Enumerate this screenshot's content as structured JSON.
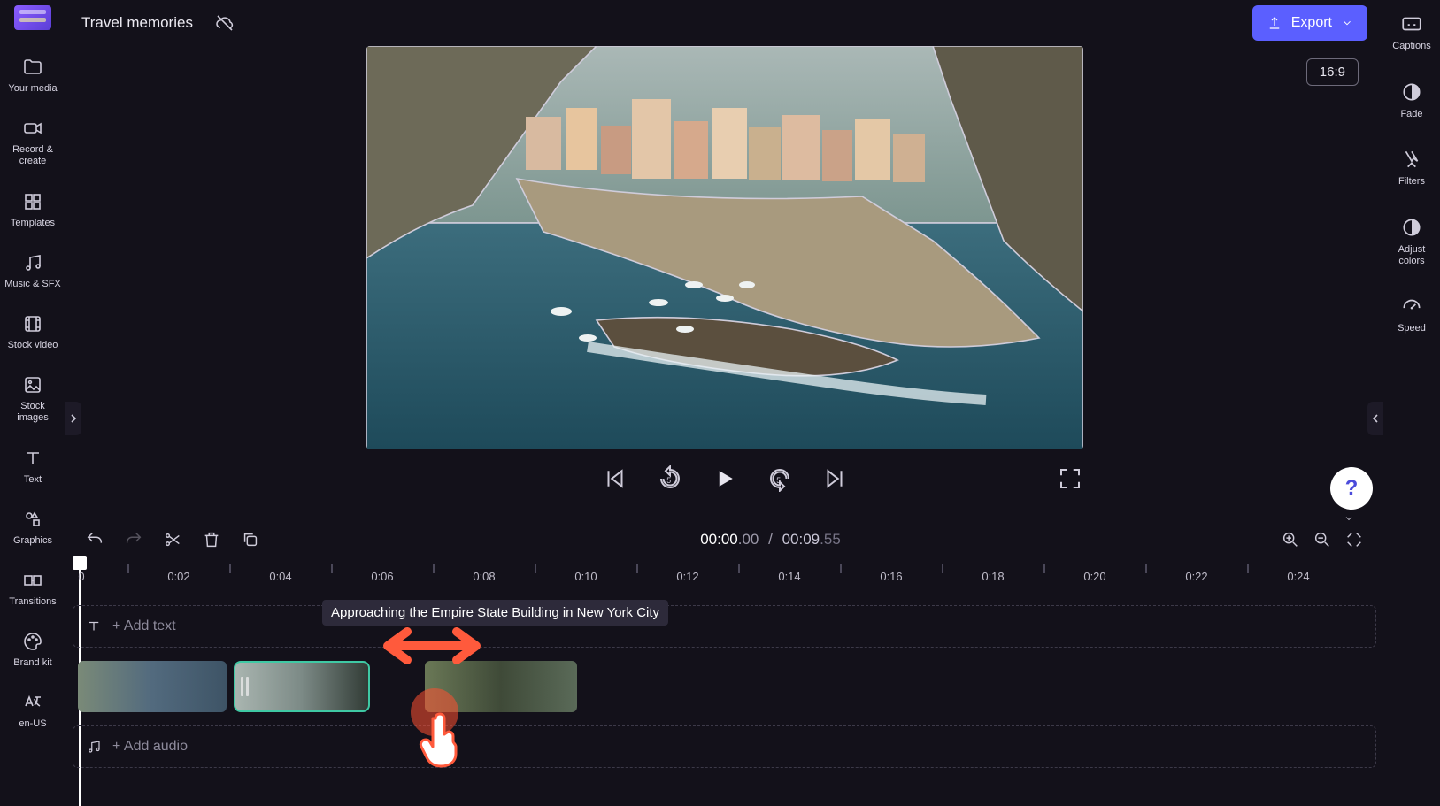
{
  "header": {
    "project_title": "Travel memories",
    "export_label": "Export",
    "aspect_ratio": "16:9"
  },
  "left_sidebar": {
    "items": [
      {
        "label": "Your media",
        "icon": "folder-icon"
      },
      {
        "label": "Record &\\ncreate",
        "icon": "camera-icon"
      },
      {
        "label": "Templates",
        "icon": "grid-icon"
      },
      {
        "label": "Music & SFX",
        "icon": "music-icon"
      },
      {
        "label": "Stock video",
        "icon": "film-icon"
      },
      {
        "label": "Stock\\nimages",
        "icon": "image-icon"
      },
      {
        "label": "Text",
        "icon": "text-icon"
      },
      {
        "label": "Graphics",
        "icon": "shapes-icon"
      },
      {
        "label": "Transitions",
        "icon": "transition-icon"
      },
      {
        "label": "Brand kit",
        "icon": "palette-icon"
      },
      {
        "label": "en-US",
        "icon": "language-icon"
      }
    ]
  },
  "right_sidebar": {
    "items": [
      {
        "label": "Captions",
        "icon": "captions-icon"
      },
      {
        "label": "Fade",
        "icon": "fade-icon"
      },
      {
        "label": "Filters",
        "icon": "filters-icon"
      },
      {
        "label": "Adjust\\ncolors",
        "icon": "contrast-icon"
      },
      {
        "label": "Speed",
        "icon": "speed-icon"
      }
    ]
  },
  "timecode": {
    "current": "00:00",
    "current_frames": ".00",
    "total": "00:09",
    "total_frames": ".55"
  },
  "ruler": {
    "start": "0",
    "ticks": [
      "0:02",
      "0:04",
      "0:06",
      "0:08",
      "0:10",
      "0:12",
      "0:14",
      "0:16",
      "0:18",
      "0:20",
      "0:22",
      "0:24"
    ]
  },
  "tracks": {
    "text_placeholder": "+ Add text",
    "audio_placeholder": "+ Add audio",
    "tooltip": "Approaching the Empire State Building in New York City"
  },
  "help_label": "?"
}
